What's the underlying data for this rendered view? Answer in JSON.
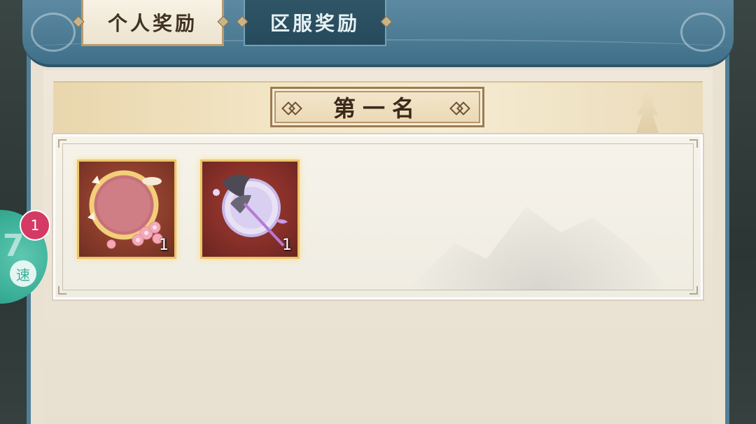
{
  "tabs": {
    "personal_label": "个人奖励",
    "server_label": "区服奖励",
    "active": "personal"
  },
  "rank": {
    "title": "第一名"
  },
  "rewards": [
    {
      "name": "cherry-blossom-frame",
      "count": "1",
      "icon": "flower-frame-icon"
    },
    {
      "name": "violet-round-fan",
      "count": "1",
      "icon": "round-fan-icon"
    }
  ],
  "speed_widget": {
    "label": "速",
    "badge": "1",
    "color": "#3aaf97"
  },
  "colors": {
    "header_blue": "#4e7c95",
    "panel_bg": "#e9e1d2",
    "item_border_gold": "#e9c56c",
    "badge_pink": "#d43a63"
  }
}
